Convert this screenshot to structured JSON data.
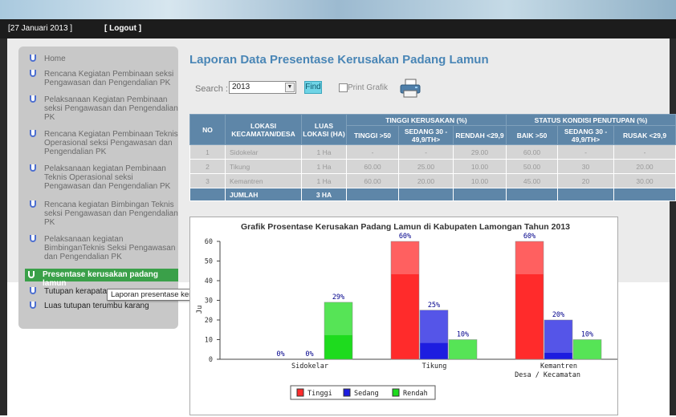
{
  "topbar": {
    "date": "[27 Januari 2013 ]",
    "logout": "[ Logout ]"
  },
  "sidebar": {
    "items": [
      {
        "label": "Home"
      },
      {
        "label": "Rencana Kegiatan Pembinaan seksi Pengawasan dan Pengendalian PK"
      },
      {
        "label": "Pelaksanaan Kegiatan Pembinaan seksi Pengawasan dan Pengendalian PK"
      },
      {
        "label": "Rencana Kegiatan Pembinaan Teknis Operasional seksi Pengawasan dan Pengendalian PK"
      },
      {
        "label": "Pelaksanaan kegiatan Pembinaan Teknis Operasional seksi Pengawasan dan Pengendalian PK"
      },
      {
        "label": "Rencana kegiatan Bimbingan Teknis seksi Pengawasan dan Pengendalian PK"
      },
      {
        "label": "Pelaksanaan kegiatan BimbinganTeknis Seksi Pengawasan dan Pengendalian PK"
      },
      {
        "label": "Presentase kerusakan padang lamun"
      },
      {
        "label": "Tutupan kerapatan"
      },
      {
        "label": "Luas tutupan terumbu karang"
      }
    ],
    "tooltip": "Laporan presentase kerusakan padang lamun"
  },
  "main": {
    "title": "Laporan Data Presentase Kerusakan Padang Lamun",
    "search_label": "Search :",
    "search_value": "2013",
    "find_label": "Find",
    "print_label": "Print Grafik"
  },
  "table": {
    "group_headers": {
      "tinggi": "TINGGI KERUSAKAN (%)",
      "status": "STATUS KONDISI PENUTUPAN (%)"
    },
    "headers": {
      "no": "NO",
      "lokasi": "LOKASI KECAMATAN/DESA",
      "luas": "LUAS LOKASI (HA)",
      "tinggi": "TINGGI >50",
      "sedang": "SEDANG 30 - 49,9/TH>",
      "rendah": "RENDAH <29,9",
      "baik": "BAIK >50",
      "sedang2": "SEDANG 30 - 49,9/TH>",
      "rusak": "RUSAK <29,9"
    },
    "rows": [
      {
        "no": "1",
        "lokasi": "Sidokelar",
        "luas": "1 Ha",
        "tinggi": "-",
        "sedang": "-",
        "rendah": "29.00",
        "baik": "60.00",
        "sedang2": "-",
        "rusak": "-"
      },
      {
        "no": "2",
        "lokasi": "Tikung",
        "luas": "1 Ha",
        "tinggi": "60.00",
        "sedang": "25.00",
        "rendah": "10.00",
        "baik": "50.00",
        "sedang2": "30",
        "rusak": "20.00"
      },
      {
        "no": "3",
        "lokasi": "Kemantren",
        "luas": "1 Ha",
        "tinggi": "60.00",
        "sedang": "20.00",
        "rendah": "10.00",
        "baik": "45.00",
        "sedang2": "20",
        "rusak": "30.00"
      }
    ],
    "sum": {
      "label": "JUMLAH",
      "luas": "3 HA"
    }
  },
  "chart_data": {
    "type": "bar",
    "title": "Grafik Prosentase Kerusakan Padang Lamun di Kabupaten Lamongan Tahun 2013",
    "xlabel": "Desa / Kecamatan",
    "ylabel": "Ju",
    "categories": [
      "Sidokelar",
      "Tikung",
      "Kemantren"
    ],
    "series": [
      {
        "name": "Tinggi",
        "values": [
          0,
          60,
          60
        ],
        "labels": [
          "0%",
          "60%",
          "60%"
        ],
        "color": "#ff2b2b"
      },
      {
        "name": "Sedang",
        "values": [
          0,
          25,
          20
        ],
        "labels": [
          "0%",
          "25%",
          "20%"
        ],
        "color": "#1d1de0"
      },
      {
        "name": "Rendah",
        "values": [
          29,
          10,
          10
        ],
        "labels": [
          "29%",
          "10%",
          "10%"
        ],
        "color": "#1edb1e"
      }
    ],
    "ylim": [
      0,
      60
    ],
    "yticks": [
      "0",
      "10",
      "20",
      "30",
      "40",
      "50",
      "60"
    ],
    "grid": false,
    "legend": "bottom"
  }
}
